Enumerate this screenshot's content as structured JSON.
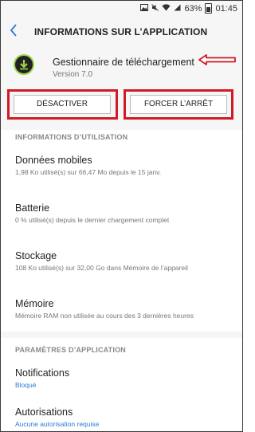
{
  "statusbar": {
    "battery": "63%",
    "time": "01:45"
  },
  "header": {
    "back_icon": "chevron-left-icon",
    "title": "INFORMATIONS SUR L’APPLICATION"
  },
  "app": {
    "name": "Gestionnaire de téléchargement",
    "version": "Version 7.0"
  },
  "buttons": {
    "disable": "DÉSACTIVER",
    "force_stop": "FORCER L’ARRÊT"
  },
  "usage": {
    "heading": "INFORMATIONS D’UTILISATION",
    "items": [
      {
        "title": "Données mobiles",
        "subtitle": "1,98 Ko utilisé(s) sur 66,47 Mo depuis le 15 janv."
      },
      {
        "title": "Batterie",
        "subtitle": "0 % utilisé(s) depuis le dernier chargement complet"
      },
      {
        "title": "Stockage",
        "subtitle": "108 Ko utilisé(s) sur 32,00 Go dans Mémoire de l’appareil"
      },
      {
        "title": "Mémoire",
        "subtitle": "Mémoire RAM non utilisée au cours des 3 dernières heures"
      }
    ]
  },
  "app_settings": {
    "heading": "PARAMÈTRES D’APPLICATION",
    "items": [
      {
        "title": "Notifications",
        "subtitle": "Bloqué"
      },
      {
        "title": "Autorisations",
        "subtitle": "Aucune autorisation requise"
      }
    ]
  },
  "colors": {
    "accent": "#2b7bd6",
    "highlight": "#d11a24",
    "app_icon_ring": "#9bd54a"
  }
}
